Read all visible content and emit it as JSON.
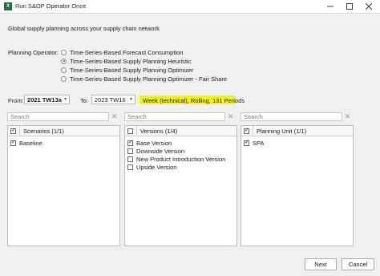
{
  "window": {
    "title": "Run S&OP Operator Once",
    "app_icon": "excel-icon"
  },
  "description": "Global supply planning across your supply chain network",
  "operator": {
    "label": "Planning Operator:",
    "options": [
      "Time-Series-Based Forecast Consumption",
      "Time-Series-Based Supply Planning Heuristic",
      "Time-Series-Based Supply Planning Optimizer",
      "Time-Series-Based Supply Planning Optimizer - Fair Share"
    ],
    "selected_index": 1
  },
  "range": {
    "from_label": "From:",
    "from_value": "2021 TW13a",
    "to_label": "To:",
    "to_value": "2023 TW16",
    "info": "Week (technical), Rolling, 131 Periods",
    "highlight_color": "#f5f50a"
  },
  "search_placeholder": "Search",
  "scenarios": {
    "header": "Scenarios (1/1)",
    "items": [
      "Baseline"
    ]
  },
  "versions": {
    "header": "Versions (1/4)",
    "items": [
      "Base Version",
      "Downside Version",
      "New Product Introduction Version",
      "Upside Version"
    ]
  },
  "planning_units": {
    "header": "Planning Unit (1/1)",
    "items": [
      "SPA"
    ]
  },
  "buttons": {
    "next": "Next",
    "cancel": "Cancel"
  }
}
